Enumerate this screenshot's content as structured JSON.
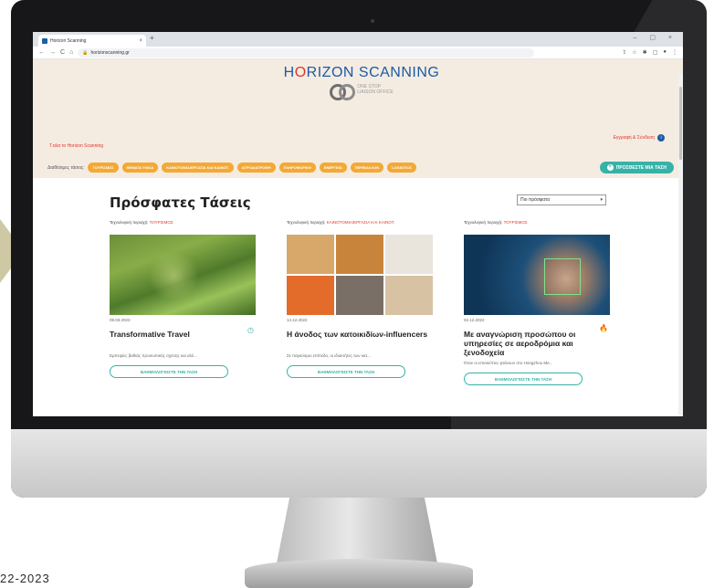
{
  "browser": {
    "tab_title": "Horizon Scanning",
    "tab_close": "×",
    "new_tab": "+",
    "window_controls": "– ▢ ×",
    "url": "horizonscanning.gr",
    "nav": {
      "back": "←",
      "forward": "→",
      "reload": "C",
      "home": "⌂"
    }
  },
  "site": {
    "logo_prefix": "H",
    "logo_o": "O",
    "logo_suffix": "RIZON SCANNING",
    "logo_sub_line1": "ONE STOP",
    "logo_sub_line2": "LIAISON OFFICE",
    "welcome": "Τ.αλα το Horizon Scanning",
    "login": "Εγγραφή & Σύνδεση",
    "filter_label": "Διαθέσιμες τάσεις:",
    "filters": [
      "ΤΟΥΡΙΣΜΟΣ",
      "ΘΕΜΑΤΑ ΥΛΙΚΑ",
      "ΚΑΙΝΟΤΟΜΙΑ/ΕΡΓΑΣΙΑ ΚΑΙ ΚΑΙΝΟΤ.",
      "ΑΓΡΟΔΙΑΤΡΟΦΗ",
      "ΠΛΗΡΟΦΟΡΙΚΗ",
      "ΕΝΕΡΓΕΙΑ",
      "ΠΕΡΙΒΑΛΛΟΝ",
      "LOGISTICS"
    ],
    "add_trend": "ΠΡΟΣΘΕΣΤΕ ΜΙΑ ΤΑΣΗ"
  },
  "main": {
    "title": "Πρόσφατες Τάσεις",
    "sort_value": "Πιο πρόσφατα",
    "cards": [
      {
        "area_label": "Τεχνολογική περιοχή:",
        "area_value": "ΤΟΥΡΙΣΜΟΣ",
        "date": "09.03.2023",
        "title": "Transformative Travel",
        "excerpt": "Εμπειρίες βαθιάς προσωπικής σχέσης και αλλ...",
        "button": "ΒΑΘΜΟΛΟΓΕΙΣΤΕ ΤΗΝ ΤΑΣΗ"
      },
      {
        "area_label": "Τεχνολογική περιοχή:",
        "area_value": "ΚΑΙΝΟΤΟΜΙΑ/ΕΡΓΑΣΙΑ ΚΑΙ ΚΑΙΝΟΤ.",
        "date": "14.12.2022",
        "title": "Η άνοδος των κατοικιδίων-influencers",
        "excerpt": "Σε παγκόσμιο επίπεδο, οι ιδιοκτήτες των κατ...",
        "button": "ΒΑΘΜΟΛΟΓΕΙΣΤΕ ΤΗΝ ΤΑΣΗ"
      },
      {
        "area_label": "Τεχνολογική περιοχή:",
        "area_value": "ΤΟΥΡΙΣΜΟΣ",
        "date": "02.12.2022",
        "title": "Με αναγνώριση προσώπου οι υπηρεσίες σε αεροδρόμια και ξενοδοχεία",
        "excerpt": "Όταν οι επισκέπτες φτάνουν στο Hongzhou Me...",
        "button": "ΒΑΘΜΟΛΟΓΕΙΣΤΕ ΤΗΝ ΤΑΣΗ"
      }
    ]
  },
  "footer_date": "22-2023",
  "colors": {
    "brand_blue": "#1c5aa6",
    "brand_red": "#e1352b",
    "pill_orange": "#f4a935",
    "accent_teal": "#36b3a8",
    "header_bg": "#f4ece1"
  }
}
